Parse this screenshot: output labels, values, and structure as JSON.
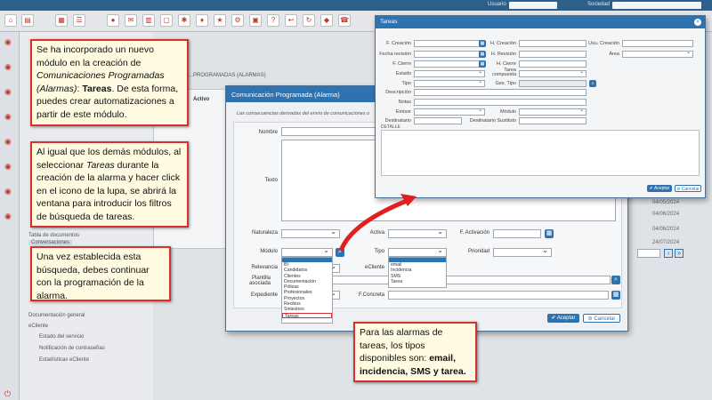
{
  "topbar": {
    "user_label": "Usuario",
    "company_label": "Sociedad"
  },
  "toolbar": {
    "icons": [
      "home-icon",
      "folder-icon",
      "calendar-icon",
      "list-icon",
      "user-icon"
    ]
  },
  "sidebar": {
    "items": [
      {
        "label": "Tabla de documentos"
      },
      {
        "label": "Conversaciones"
      },
      {
        "label": "Documentación general"
      },
      {
        "label": "eCliente"
      },
      {
        "label": "Estado del servicio"
      },
      {
        "label": "Notificación de contraseñas"
      },
      {
        "label": "Estadísticas eCliente"
      }
    ]
  },
  "background": {
    "panel_title": "...PROGRAMADAS (ALARMAS)",
    "column_activo": "Activo",
    "dates": [
      "04/05/2024",
      "04/06/2024",
      "04/06/2024",
      "24/07/2024"
    ]
  },
  "callouts": {
    "c1": {
      "text1": "Se ha incorporado un nuevo módulo en la creación de ",
      "italic": "Comunicaciones Programadas (Alarmas)",
      "text2": ": ",
      "bold": "Tareas",
      "text3": ". De esta forma, puedes crear automatizaciones a partir de este módulo."
    },
    "c2": {
      "text1": "Al igual que los demás módulos, al seleccionar ",
      "italic": "Tareas",
      "text2": " durante la creación de la alarma y hacer click en el icono de la lupa, se abrirá la ventana para introducir los filtros de búsqueda de tareas."
    },
    "c3": {
      "text": "Una vez establecida esta búsqueda, debes continuar con la programación de la alarma."
    },
    "c4": {
      "text1": "Para las alarmas de tareas, los tipos disponibles son: ",
      "bold": "email, incidencia, SMS y tarea."
    }
  },
  "main_dialog": {
    "title": "Comunicación Programada (Alarma)",
    "subtitle": "Las consecuencias derivadas del envío de comunicaciones o",
    "labels": {
      "nombre": "Nombre",
      "texto": "Texto",
      "naturaleza": "Naturaleza",
      "activa": "Activa",
      "f_activacion": "F. Activación",
      "modulo": "Módulo",
      "tipo": "Tipo",
      "prioridad": "Prioridad",
      "relevancia": "Relevancia",
      "ecliente": "eCliente",
      "plantilla": "Plantilla asociada",
      "expediente": "Expediente",
      "f_concreta": "F.Concreta"
    },
    "modulo_options": [
      "",
      "BI",
      "Candidatos",
      "Clientes",
      "Documentación",
      "Pólizas",
      "Profesionales",
      "Proyectos",
      "Recibos",
      "Siniestros",
      "Tareas"
    ],
    "tipo_options": [
      "",
      "email",
      "Incidencia",
      "SMS",
      "Tarea"
    ],
    "accept": "Aceptar",
    "cancel": "Cancelar"
  },
  "tareas_dialog": {
    "title": "Tareas",
    "labels": {
      "f_creacion": "F. Creación",
      "h_creacion": "H. Creación",
      "usu_creacion": "Usu. Creación",
      "fecha_revision": "Fecha revisión",
      "h_revision": "H. Revisión",
      "area": "Área",
      "f_cierre": "F. Cierre",
      "h_cierre": "H. Cierre",
      "estado": "Estado",
      "tarea_compuesta": "Tarea compuesta",
      "tipo": "Tipo",
      "ges_tipo": "Ges. Tipo",
      "descripcion": "Descripción",
      "notas": "Notas",
      "emisor": "Emisor",
      "modulo": "Módulo",
      "destinatario": "Destinatario",
      "destinatario_sustituto": "Destinatario Sustituto",
      "detalle": "DETALLE"
    },
    "accept": "Aceptar",
    "cancel": "Cancelar"
  },
  "colors": {
    "accent": "#2f72b0",
    "callout_border": "#d9302f",
    "callout_bg": "#fffbe0"
  }
}
